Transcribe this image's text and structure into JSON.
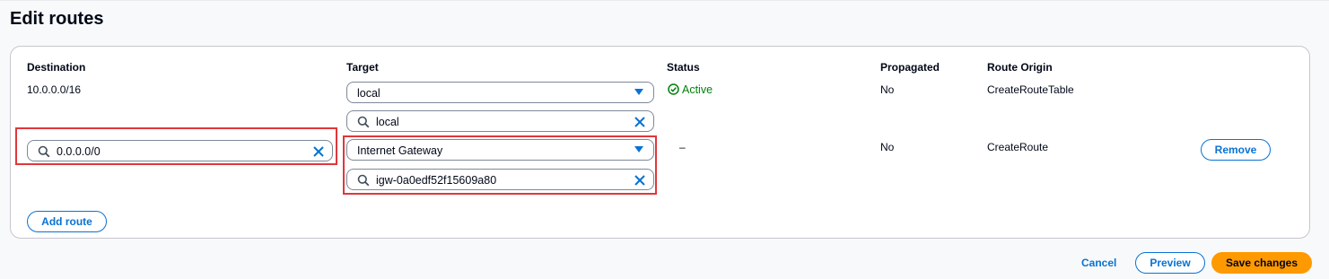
{
  "page": {
    "title": "Edit routes"
  },
  "table": {
    "headers": {
      "destination": "Destination",
      "target": "Target",
      "status": "Status",
      "propagated": "Propagated",
      "route_origin": "Route Origin"
    },
    "rows": [
      {
        "destination": "10.0.0.0/16",
        "target_select": "local",
        "target_search": "local",
        "status": "Active",
        "propagated": "No",
        "route_origin": "CreateRouteTable"
      },
      {
        "destination": "0.0.0.0/0",
        "target_select": "Internet Gateway",
        "target_search": "igw-0a0edf52f15609a80",
        "status": "–",
        "propagated": "No",
        "route_origin": "CreateRoute",
        "remove_label": "Remove"
      }
    ],
    "add_route_label": "Add route"
  },
  "footer": {
    "cancel_label": "Cancel",
    "preview_label": "Preview",
    "save_label": "Save changes"
  },
  "colors": {
    "accent": "#0972d3",
    "primary_button": "#ff9900",
    "status_active": "#037f0c",
    "highlight": "#e0373a"
  },
  "icons": [
    "search-icon",
    "clear-icon",
    "caret-down-icon",
    "check-circle-icon"
  ]
}
